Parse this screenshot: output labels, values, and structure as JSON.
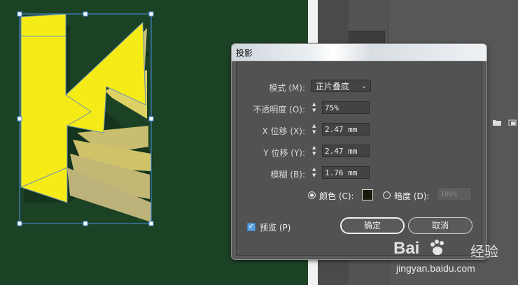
{
  "artwork": {
    "letter": "K",
    "fill_color": "#f5ec17",
    "shadow_color": "#c9c070",
    "selection_color": "#4a90e2",
    "background": "#1c4226"
  },
  "dialog": {
    "title": "投影",
    "mode_label": "模式 (M):",
    "mode_value": "正片叠底",
    "opacity_label": "不透明度 (O):",
    "opacity_value": "75%",
    "x_offset_label": "X 位移 (X):",
    "x_offset_value": "2.47 mm",
    "y_offset_label": "Y 位移 (Y):",
    "y_offset_value": "2.47 mm",
    "blur_label": "模糊 (B):",
    "blur_value": "1.76 mm",
    "color_label": "颜色 (C):",
    "color_swatch": "#1a1a0a",
    "color_selected": true,
    "darkness_label": "暗度 (D):",
    "darkness_value": "100%",
    "preview_label": "预览 (P)",
    "preview_checked": true,
    "ok_label": "确定",
    "cancel_label": "取消"
  },
  "watermark": {
    "brand": "Bai",
    "brand_suffix": "经验",
    "url": "jingyan.baidu.com"
  }
}
